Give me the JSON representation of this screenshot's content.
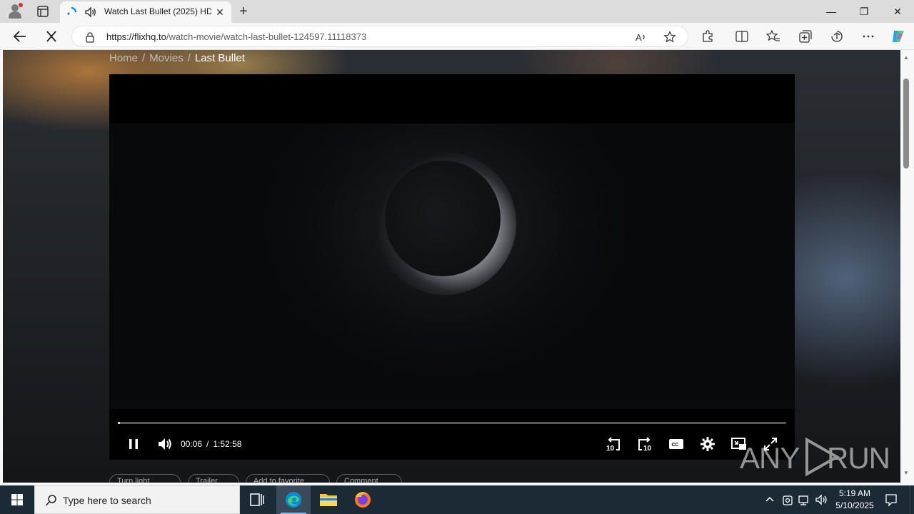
{
  "browser": {
    "tab_title": "Watch Last Bullet (2025) HD",
    "url_host": "https://flixhq.to",
    "url_path": "/watch-movie/watch-last-bullet-124597.11118373",
    "window_controls": {
      "minimize": "—",
      "restore": "❐",
      "close": "✕"
    },
    "tab_close": "✕",
    "new_tab": "+"
  },
  "page": {
    "breadcrumb": {
      "home": "Home",
      "sep": "/",
      "movies": "Movies",
      "current": "Last Bullet"
    },
    "player": {
      "time_current": "00:06",
      "time_sep": "/",
      "time_total": "1:52:58",
      "progress_fraction": 0.001
    },
    "actions": [
      "Turn light",
      "Trailer",
      "Add to favorite",
      "Comment"
    ],
    "watermark": {
      "left": "ANY",
      "right": "RUN"
    }
  },
  "taskbar": {
    "search_placeholder": "Type here to search",
    "time": "5:19 AM",
    "date": "5/10/2025"
  },
  "colors": {
    "accent": "#0078d4",
    "taskbar_bg": "#1c2a36",
    "player_bg": "#000000"
  }
}
